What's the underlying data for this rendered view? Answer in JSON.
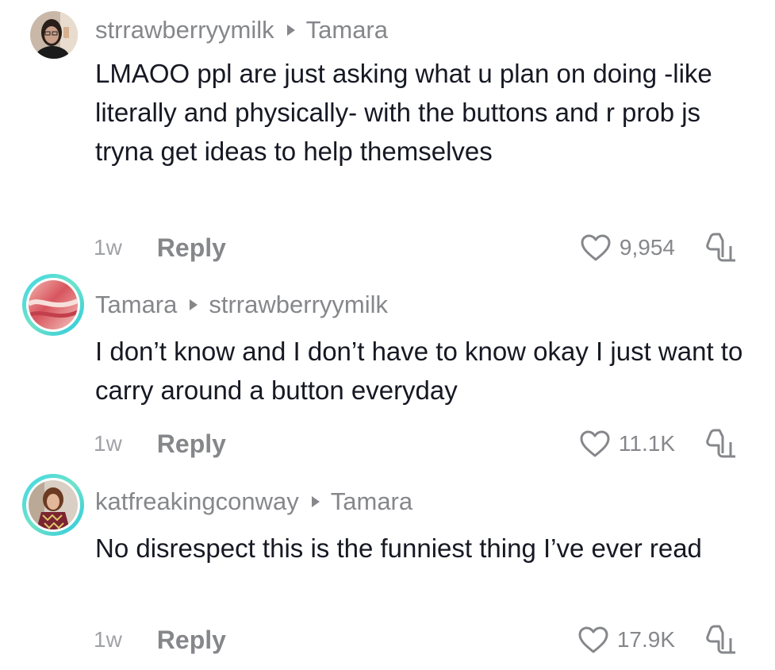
{
  "comments": [
    {
      "author": "strrawberryymilk",
      "reply_to": "Tamara",
      "text": "LMAOO ppl are just asking what u plan on doing -like literally and physically- with the buttons and r prob js tryna get ideas to help themselves",
      "age": "1w",
      "reply_label": "Reply",
      "likes": "9,954"
    },
    {
      "author": "Tamara",
      "reply_to": "strrawberryymilk",
      "text": "I don’t know and I don’t have to know okay I just want to carry around a button everyday",
      "age": "1w",
      "reply_label": "Reply",
      "likes": "11.1K"
    },
    {
      "author": "katfreakingconway",
      "reply_to": "Tamara",
      "text": "No disrespect this is the funniest thing I’ve ever read",
      "age": "1w",
      "reply_label": "Reply",
      "likes": "17.9K"
    }
  ],
  "icons": {
    "like": "heart-outline-icon",
    "dislike": "thumbs-down-outline-icon",
    "reply_arrow": "triangle-right-icon"
  },
  "colors": {
    "text": "#161823",
    "muted": "#86878b",
    "story_ring": "#3fd6e6"
  }
}
